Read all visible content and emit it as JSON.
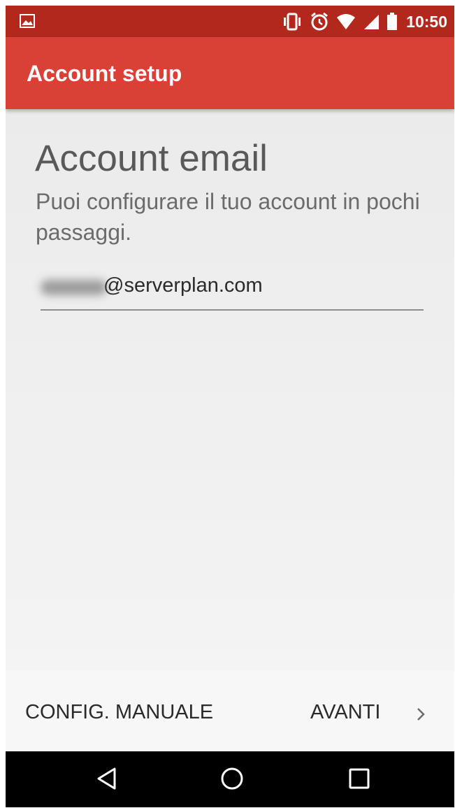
{
  "status_bar": {
    "time": "10:50",
    "icons": [
      "image-notification-icon",
      "vibrate-icon",
      "alarm-icon",
      "wifi-icon",
      "cell-signal-icon",
      "battery-icon"
    ]
  },
  "app_bar": {
    "title": "Account setup"
  },
  "main": {
    "heading": "Account email",
    "subtitle": "Puoi configurare il tuo account in pochi passaggi.",
    "email_field": {
      "value": "@serverplan.com"
    }
  },
  "bottom_bar": {
    "manual_label": "CONFIG. MANUALE",
    "next_label": "AVANTI"
  },
  "nav_bar": {
    "icons": [
      "back-icon",
      "home-icon",
      "recents-icon"
    ]
  },
  "colors": {
    "status_bar": "#b3281d",
    "app_bar": "#d94136",
    "background": "#ededed",
    "nav_bar": "#000000"
  }
}
